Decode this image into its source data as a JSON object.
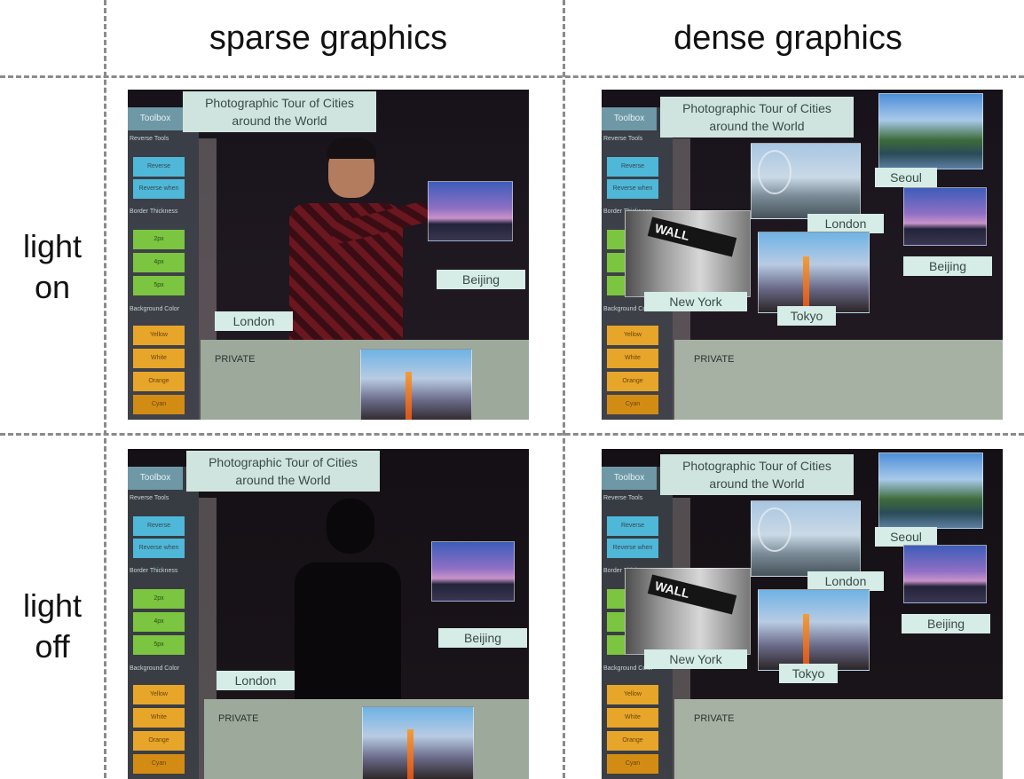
{
  "columns": [
    "sparse graphics",
    "dense graphics"
  ],
  "rows": [
    {
      "label_line1": "light",
      "label_line2": "on"
    },
    {
      "label_line1": "light",
      "label_line2": "off"
    }
  ],
  "ui": {
    "title_line1": "Photographic Tour of Cities",
    "title_line2": "around the World",
    "toolbox_title": "Toolbox",
    "sections": [
      "Reverse Tools",
      "Border Thickness",
      "Background Color"
    ],
    "reverse_buttons": [
      "Reverse",
      "Reverse when side"
    ],
    "thickness_buttons": [
      "2px",
      "4px",
      "5px"
    ],
    "color_buttons": [
      "Yellow",
      "White",
      "Orange",
      "Cyan"
    ],
    "private_label": "PRIVATE"
  },
  "cities": {
    "beijing": "Beijing",
    "london": "London",
    "seoul": "Seoul",
    "new_york": "New York",
    "tokyo": "Tokyo",
    "wall_sign": "WALL"
  }
}
